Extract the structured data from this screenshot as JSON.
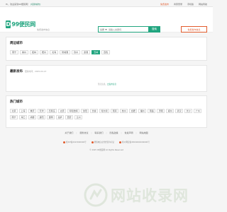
{
  "topbar": {
    "welcome": "Hi，欢迎来到99便民网！",
    "switch_city": "[切换城市]",
    "right_links": [
      "免费发布",
      "商家登录",
      "手机版",
      "网站导航"
    ]
  },
  "header": {
    "logo_letter": "D",
    "logo_text": "99便民网",
    "slogan": "免费发布信息",
    "search_category": "房屋",
    "search_placeholder": "请输入关键词",
    "search_button": "搜索",
    "free_post_button": "免费发布信息"
  },
  "nearby": {
    "title": "周边城市",
    "cities": [
      "南宁",
      "柳州",
      "桂林",
      "梧州",
      "北海",
      "防城港",
      "钦州",
      "贵港",
      "玉林",
      "百色"
    ],
    "active_index": 8
  },
  "latest": {
    "title": "最新发布",
    "subtitle": "更新时间：2025-04-13",
    "empty_text": "暂无信息，",
    "empty_link": "去发布信息"
  },
  "hot": {
    "title": "热门城市",
    "cities": [
      "北京",
      "上海",
      "重庆",
      "天津",
      "石家庄",
      "太原",
      "呼和浩特",
      "沈阳",
      "长春",
      "哈尔滨",
      "南京",
      "杭州",
      "合肥",
      "福州",
      "南昌",
      "济南",
      "郑州",
      "武汉",
      "长沙",
      "广州",
      "南宁",
      "海口",
      "成都",
      "贵阳",
      "昆明",
      "拉萨",
      "西安",
      "兰州"
    ]
  },
  "footer": {
    "links": [
      "关于我们",
      "服务协议",
      "联系我们",
      "隐私政策",
      "免责声明",
      "网站地图"
    ],
    "icp": [
      "桂ICP备2023000000号",
      "增值电信业务经营许可证",
      "桂公网安备45000002000000号"
    ],
    "copyright": "© 2025 99便民网 All Rights Reserved"
  },
  "watermark": {
    "text": "网站收录网"
  },
  "colors": {
    "brand": "#21a57f",
    "accent": "#e25b2c"
  }
}
